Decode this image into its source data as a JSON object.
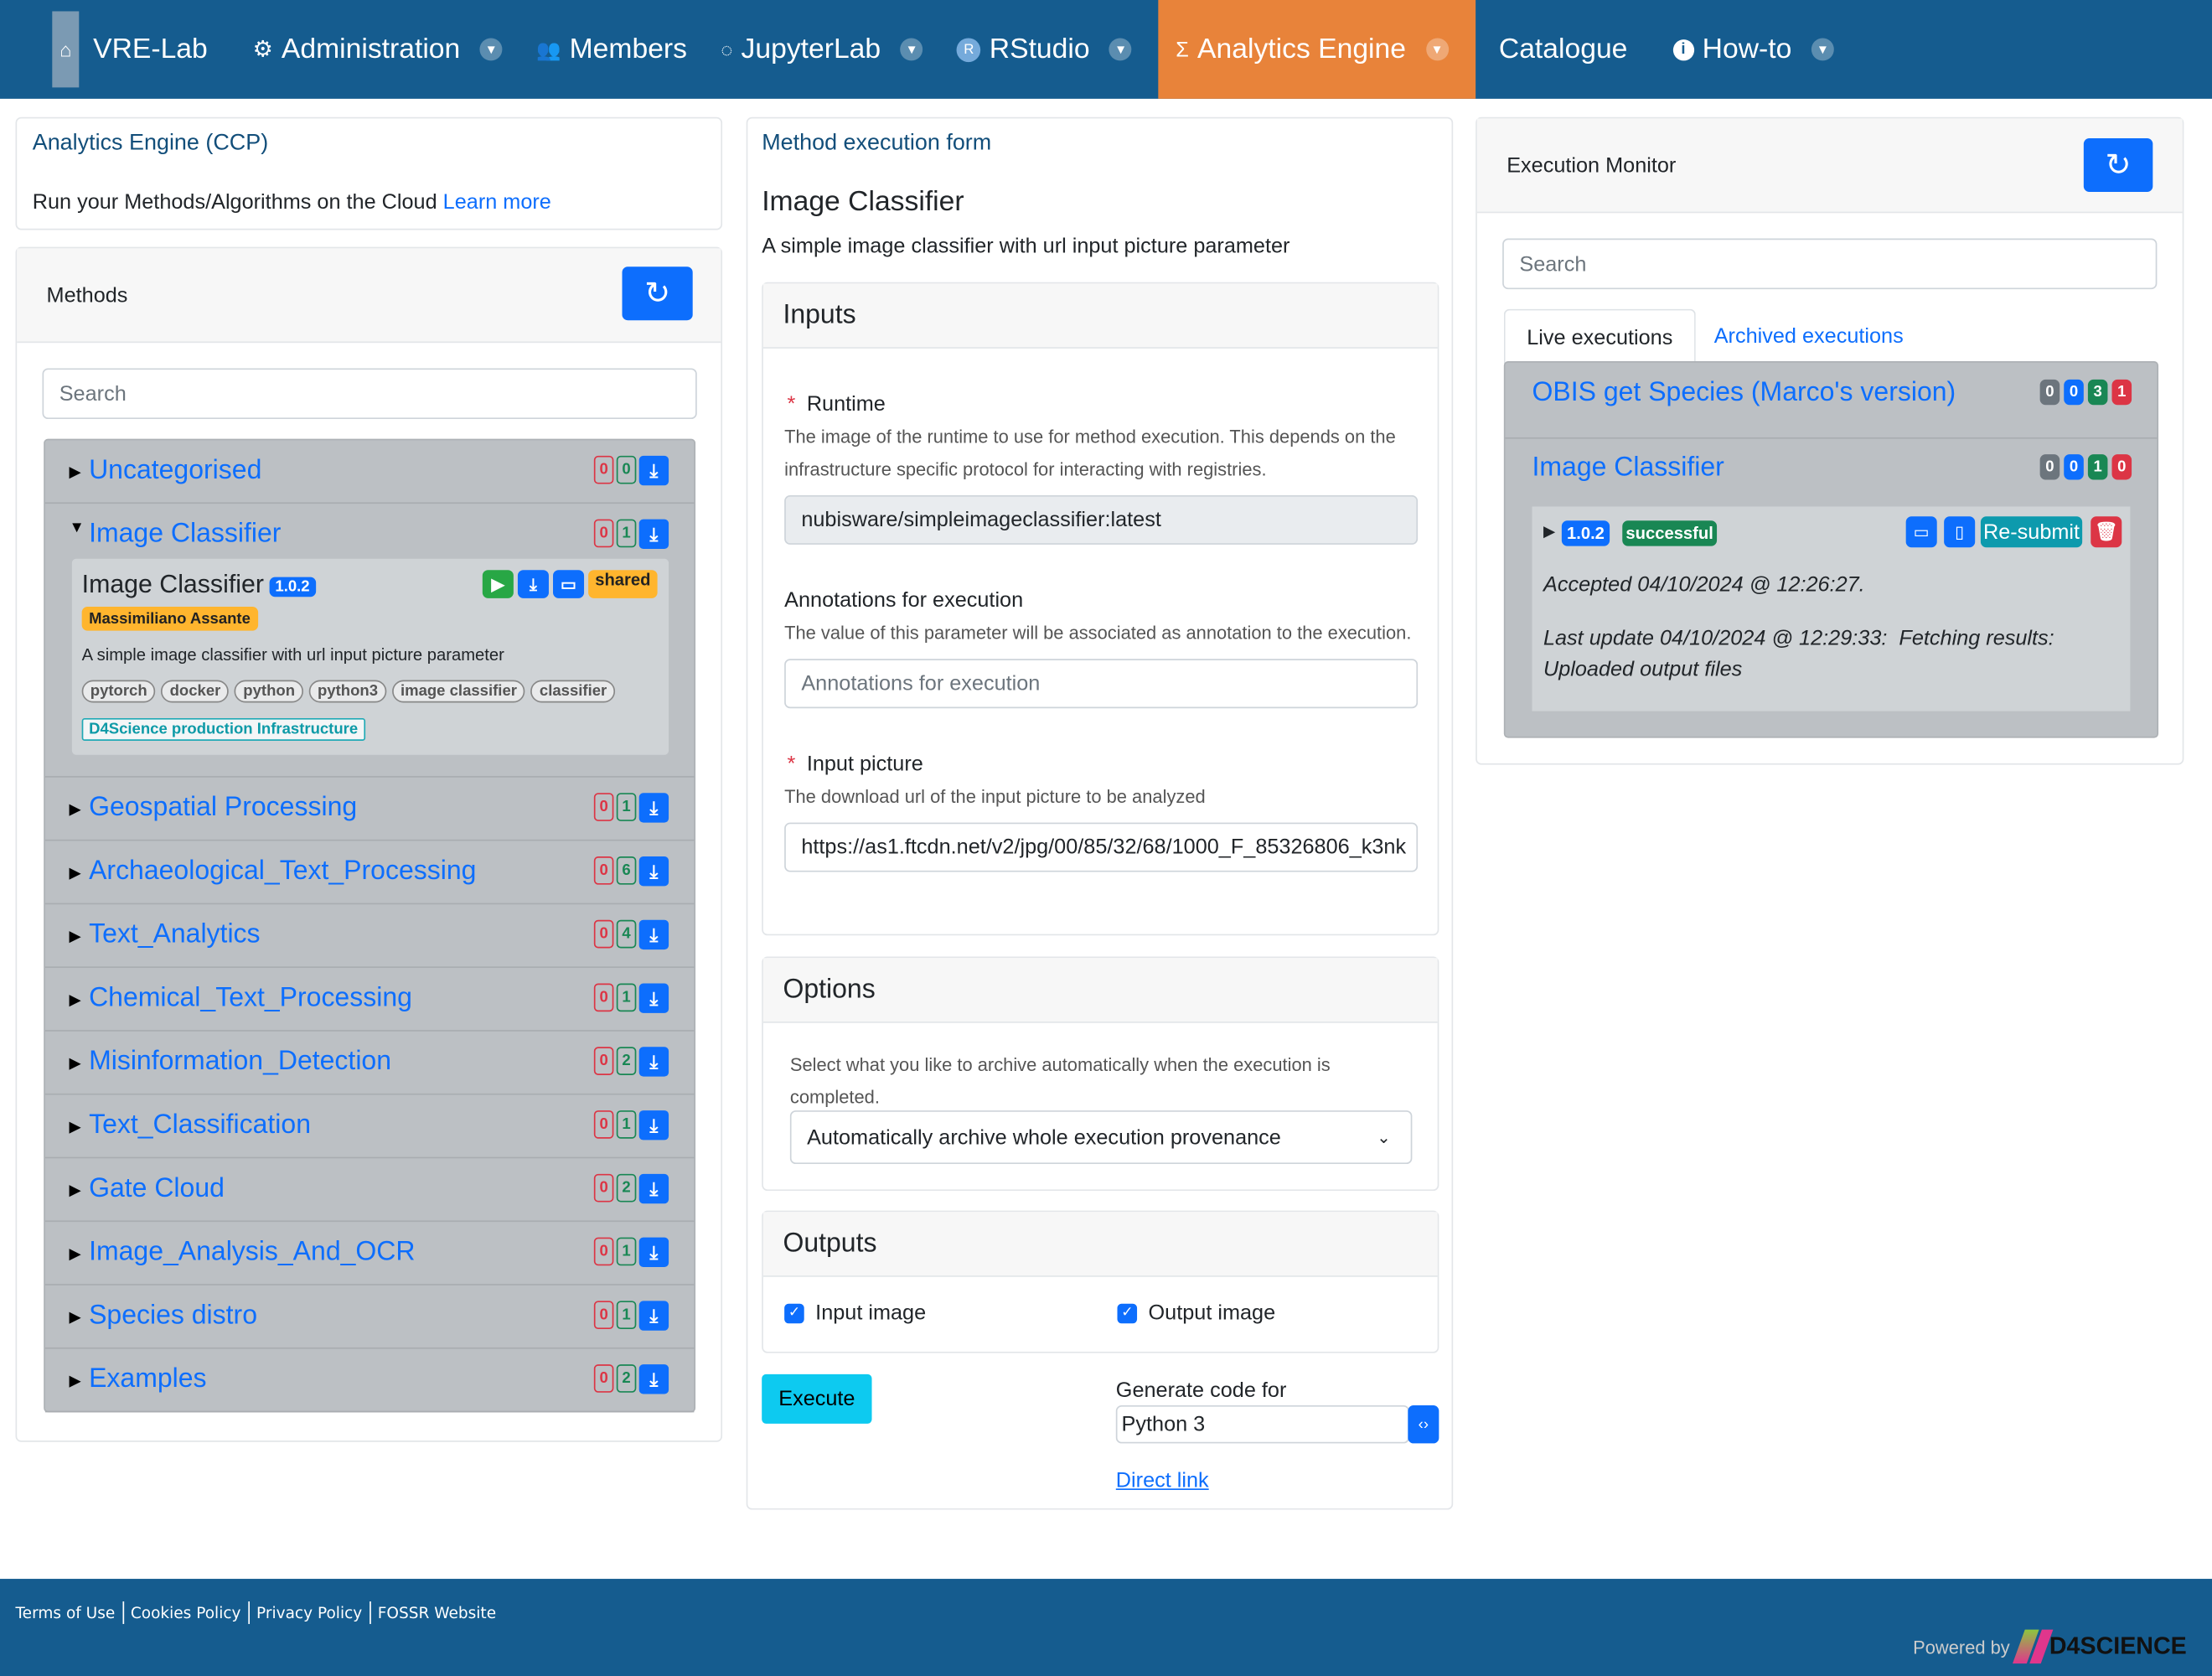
{
  "nav": {
    "items": [
      {
        "label": "VRE-Lab",
        "icon": "home-icon"
      },
      {
        "label": "Administration",
        "icon": "gear-icon",
        "dropdown": true
      },
      {
        "label": "Members",
        "icon": "users-icon"
      },
      {
        "label": "JupyterLab",
        "icon": "jupyter-icon",
        "dropdown": true
      },
      {
        "label": "RStudio",
        "icon": "rstudio-icon",
        "dropdown": true
      },
      {
        "label": "Analytics Engine",
        "icon": "sigma-icon",
        "dropdown": true,
        "active": true
      },
      {
        "label": "Catalogue"
      },
      {
        "label": "How-to",
        "icon": "info-icon",
        "dropdown": true
      }
    ],
    "active_color": "#e8833a",
    "bg_color": "#155c8f"
  },
  "intro": {
    "title": "Analytics Engine (CCP)",
    "text": "Run your Methods/Algorithms on the Cloud",
    "link": "Learn more"
  },
  "methods": {
    "title": "Methods",
    "search_placeholder": "Search",
    "categories": [
      {
        "name": "Uncategorised",
        "red": "0",
        "green": "0"
      },
      {
        "name": "Image Classifier",
        "red": "0",
        "green": "1",
        "expanded": true
      },
      {
        "name": "Geospatial Processing",
        "red": "0",
        "green": "1"
      },
      {
        "name": "Archaeological_Text_Processing",
        "red": "0",
        "green": "6"
      },
      {
        "name": "Text_Analytics",
        "red": "0",
        "green": "4"
      },
      {
        "name": "Chemical_Text_Processing",
        "red": "0",
        "green": "1"
      },
      {
        "name": "Misinformation_Detection",
        "red": "0",
        "green": "2"
      },
      {
        "name": "Text_Classification",
        "red": "0",
        "green": "1"
      },
      {
        "name": "Gate Cloud",
        "red": "0",
        "green": "2"
      },
      {
        "name": "Image_Analysis_And_OCR",
        "red": "0",
        "green": "1"
      },
      {
        "name": "Species distro",
        "red": "0",
        "green": "1"
      },
      {
        "name": "Examples",
        "red": "0",
        "green": "2"
      }
    ],
    "detail": {
      "name": "Image Classifier",
      "version": "1.0.2",
      "shared": "shared",
      "author": "Massimiliano Assante",
      "description": "A simple image classifier with url input picture parameter",
      "tags": [
        "pytorch",
        "docker",
        "python",
        "python3",
        "image classifier",
        "classifier"
      ],
      "infrastructure": "D4Science production Infrastructure"
    }
  },
  "form": {
    "header": "Method execution form",
    "title": "Image Classifier",
    "description": "A simple image classifier with url input picture parameter",
    "inputs_title": "Inputs",
    "runtime": {
      "label": "Runtime",
      "help": "The image of the runtime to use for method execution. This depends on the infrastructure specific protocol for interacting with registries.",
      "value": "nubisware/simpleimageclassifier:latest"
    },
    "annotations": {
      "label": "Annotations for execution",
      "help": "The value of this parameter will be associated as annotation to the execution.",
      "placeholder": "Annotations for execution"
    },
    "picture": {
      "label": "Input picture",
      "help": "The download url of the input picture to be analyzed",
      "value": "https://as1.ftcdn.net/v2/jpg/00/85/32/68/1000_F_85326806_k3nk"
    },
    "options_title": "Options",
    "options_help": "Select what you like to archive automatically when the execution is completed.",
    "options_value": "Automatically archive whole execution provenance",
    "outputs_title": "Outputs",
    "outputs": [
      {
        "label": "Input image",
        "checked": true
      },
      {
        "label": "Output image",
        "checked": true
      }
    ],
    "execute": "Execute",
    "gen_label": "Generate code for",
    "gen_value": "Python 3",
    "direct_link": "Direct link"
  },
  "monitor": {
    "title": "Execution Monitor",
    "search_placeholder": "Search",
    "tabs": [
      "Live executions",
      "Archived executions"
    ],
    "groups": [
      {
        "name": "OBIS get Species (Marco's version)",
        "counts": [
          "0",
          "0",
          "3",
          "1"
        ]
      },
      {
        "name": "Image Classifier",
        "counts": [
          "0",
          "0",
          "1",
          "0"
        ]
      }
    ],
    "execution": {
      "version": "1.0.2",
      "status": "successful",
      "resubmit": "Re-submit",
      "accepted": "Accepted 04/10/2024 @ 12:26:27.",
      "update": "Last update 04/10/2024 @ 12:29:33:  Fetching results: Uploaded output files"
    }
  },
  "footer": {
    "links": [
      "Terms of Use",
      "Cookies Policy",
      "Privacy Policy",
      "FOSSR Website"
    ],
    "powered": "Powered by",
    "brand": "D4SCIENCE"
  }
}
